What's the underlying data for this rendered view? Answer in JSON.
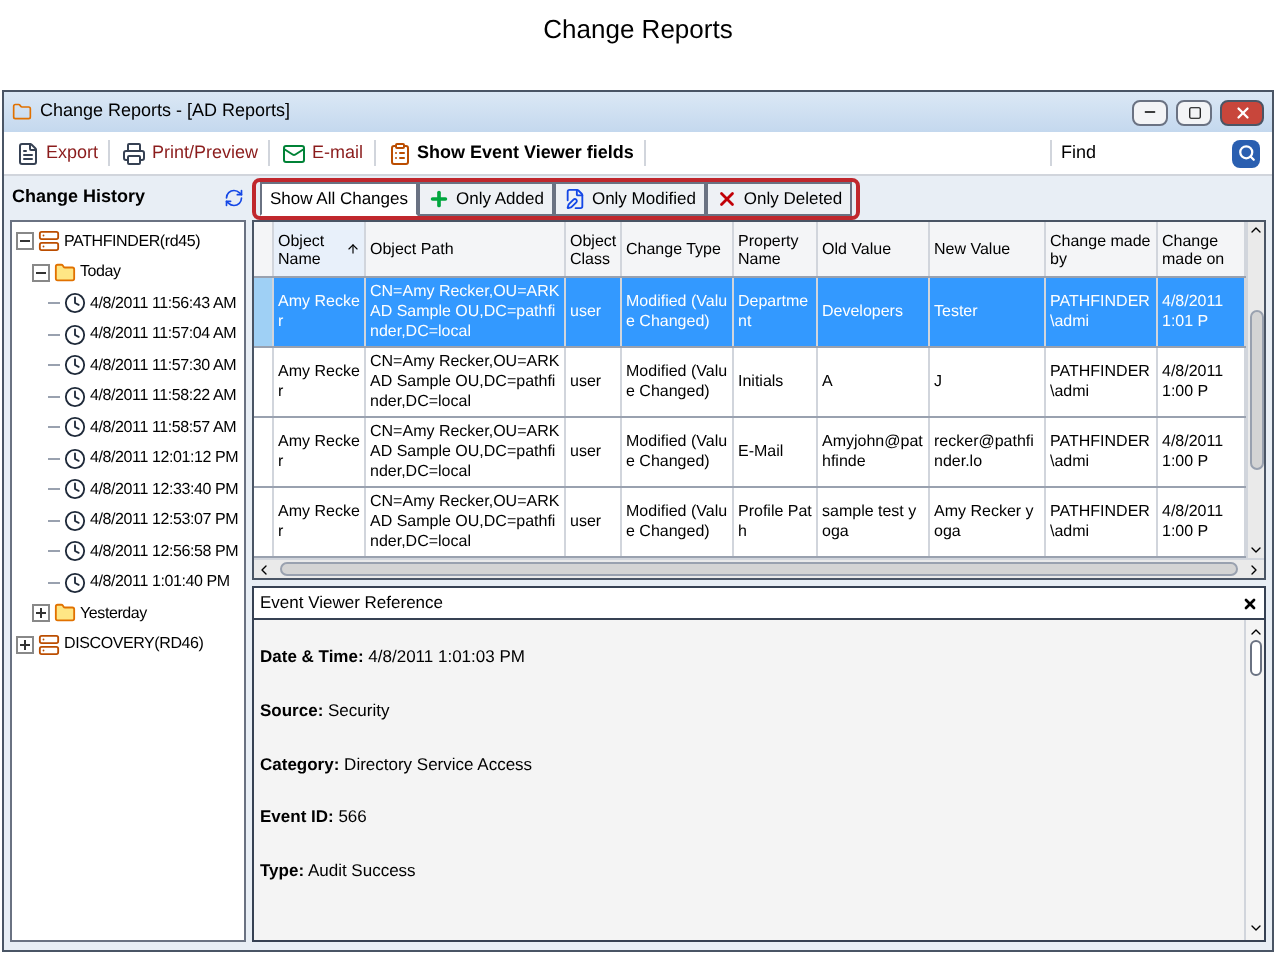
{
  "page_title": "Change Reports",
  "window": {
    "title": "Change Reports - [AD Reports]"
  },
  "toolbar": {
    "items": [
      {
        "label": "Export",
        "kind": "export"
      },
      {
        "label": "Print/Preview",
        "kind": "print"
      },
      {
        "label": "E-mail",
        "kind": "email"
      },
      {
        "label": "Show Event Viewer fields",
        "kind": "toggle"
      }
    ],
    "find_label": "Find"
  },
  "sidebar": {
    "title": "Change History",
    "tree": [
      {
        "label": "PATHFINDER(rd45)",
        "kind": "server",
        "expanded": true,
        "children": [
          {
            "label": "Today",
            "kind": "folder",
            "expanded": true,
            "children": [
              {
                "label": "4/8/2011 11:56:43 AM",
                "kind": "time"
              },
              {
                "label": "4/8/2011 11:57:04 AM",
                "kind": "time"
              },
              {
                "label": "4/8/2011 11:57:30 AM",
                "kind": "time"
              },
              {
                "label": "4/8/2011 11:58:22 AM",
                "kind": "time"
              },
              {
                "label": "4/8/2011 11:58:57 AM",
                "kind": "time"
              },
              {
                "label": "4/8/2011 12:01:12 PM",
                "kind": "time"
              },
              {
                "label": "4/8/2011 12:33:40 PM",
                "kind": "time"
              },
              {
                "label": "4/8/2011 12:53:07 PM",
                "kind": "time"
              },
              {
                "label": "4/8/2011 12:56:58 PM",
                "kind": "time"
              },
              {
                "label": "4/8/2011 1:01:40 PM",
                "kind": "time"
              }
            ]
          },
          {
            "label": "Yesterday",
            "kind": "folder",
            "expanded": false
          }
        ]
      },
      {
        "label": "DISCOVERY(RD46)",
        "kind": "server",
        "expanded": false
      }
    ]
  },
  "filter_tabs": [
    {
      "label": "Show All Changes",
      "kind": "all",
      "selected": true
    },
    {
      "label": "Only Added",
      "kind": "added",
      "selected": false
    },
    {
      "label": "Only Modified",
      "kind": "modified",
      "selected": false
    },
    {
      "label": "Only Deleted",
      "kind": "deleted",
      "selected": false
    }
  ],
  "table": {
    "columns": [
      {
        "label": "Object Name",
        "sorted": true
      },
      {
        "label": "Object Path",
        "sorted": false
      },
      {
        "label": "Object Class",
        "sorted": false
      },
      {
        "label": "Change Type",
        "sorted": false
      },
      {
        "label": "Property Name",
        "sorted": false
      },
      {
        "label": "Old Value",
        "sorted": false
      },
      {
        "label": "New Value",
        "sorted": false
      },
      {
        "label": "Change made by",
        "sorted": false
      },
      {
        "label": "Change made on",
        "sorted": false
      }
    ],
    "rows": [
      {
        "selected": true,
        "cells": [
          "Amy Recker",
          "CN=Amy Recker,OU=ARKAD Sample OU,DC=pathfinder,DC=local",
          "user",
          "Modified (Value Changed)",
          "Department",
          "Developers",
          "Tester",
          "PATHFINDER\\admi",
          "4/8/2011 1:01 P"
        ]
      },
      {
        "selected": false,
        "cells": [
          "Amy Recker",
          "CN=Amy Recker,OU=ARKAD Sample OU,DC=pathfinder,DC=local",
          "user",
          "Modified (Value Changed)",
          "Initials",
          "A",
          "J",
          "PATHFINDER\\admi",
          "4/8/2011 1:00 P"
        ]
      },
      {
        "selected": false,
        "cells": [
          "Amy Recker",
          "CN=Amy Recker,OU=ARKAD Sample OU,DC=pathfinder,DC=local",
          "user",
          "Modified (Value Changed)",
          "E-Mail",
          "Amyjohn@pathfinde",
          "recker@pathfinder.lo",
          "PATHFINDER\\admi",
          "4/8/2011 1:00 P"
        ]
      },
      {
        "selected": false,
        "cells": [
          "Amy Recker",
          "CN=Amy Recker,OU=ARKAD Sample OU,DC=pathfinder,DC=local",
          "user",
          "Modified (Value Changed)",
          "Profile Path",
          "sample test yoga",
          "Amy Recker yoga",
          "PATHFINDER\\admi",
          "4/8/2011 1:00 P"
        ]
      }
    ]
  },
  "event_viewer": {
    "title": "Event Viewer Reference",
    "lines": [
      "**Date & Time:** 4/8/2011 1:01:03 PM",
      "**Source:** Security",
      "**Category:** Directory Service Access",
      "**Event ID:** 566",
      "**Type:** Audit Success"
    ]
  }
}
